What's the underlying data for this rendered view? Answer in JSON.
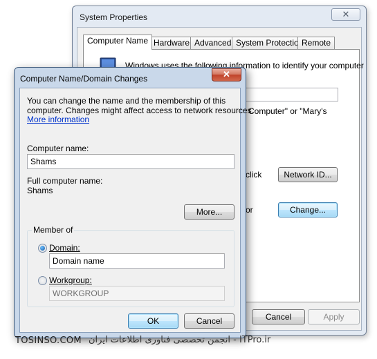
{
  "system_properties": {
    "title": "System Properties",
    "close_glyph": "✕",
    "tabs": [
      {
        "label": "Computer Name",
        "active": true
      },
      {
        "label": "Hardware",
        "active": false
      },
      {
        "label": "Advanced",
        "active": false
      },
      {
        "label": "System Protection",
        "active": false
      },
      {
        "label": "Remote",
        "active": false
      }
    ],
    "description_fragment": "Windows uses the following information to identify your computer",
    "example_fragment": "n Computer\" or \"Mary's",
    "network_hint_fragment": "click",
    "change_hint_fragment": "or",
    "network_id_label": "Network ID...",
    "change_label": "Change...",
    "cancel_label": "Cancel",
    "apply_label": "Apply"
  },
  "dialog": {
    "title": "Computer Name/Domain Changes",
    "close_glyph": "✕",
    "description_line1": "You can change the name and the membership of this",
    "description_line2": "computer. Changes might affect access to network resources.",
    "more_info_link": "More information",
    "computer_name_label": "Computer name:",
    "computer_name_value": "Shams",
    "full_name_label": "Full computer name:",
    "full_name_value": "Shams",
    "more_button": "More...",
    "member_of_label": "Member of",
    "domain_label": "Domain:",
    "domain_value": "Domain name",
    "workgroup_label": "Workgroup:",
    "workgroup_value": "WORKGROUP",
    "ok_label": "OK",
    "cancel_label": "Cancel"
  },
  "watermark": {
    "left": "TOSINSO.COM",
    "right": "انجمن تخصصی فناوری اطلاعات ایران - ITPro.ir"
  }
}
